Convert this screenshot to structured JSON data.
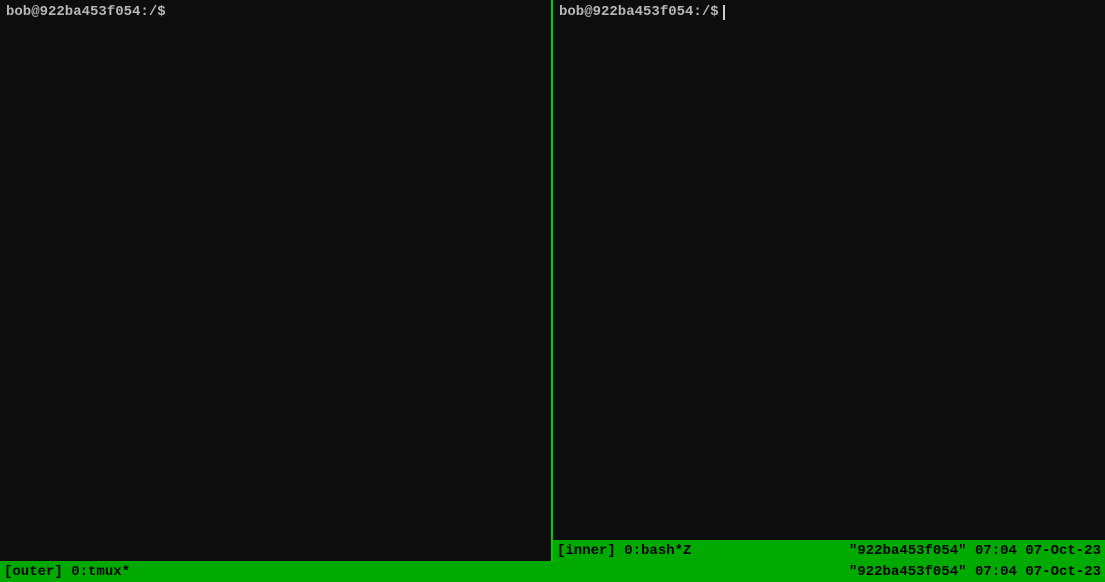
{
  "left_pane": {
    "prompt": "bob@922ba453f054:/$"
  },
  "right_pane": {
    "prompt": "bob@922ba453f054:/$"
  },
  "inner_status": {
    "session": "[inner]",
    "window": "0:bash*Z",
    "host": "\"922ba453f054\"",
    "time": "07:04",
    "date": "07-Oct-23"
  },
  "outer_status": {
    "session": "[outer]",
    "window": "0:tmux*",
    "host": "\"922ba453f054\"",
    "time": "07:04",
    "date": "07-Oct-23"
  }
}
